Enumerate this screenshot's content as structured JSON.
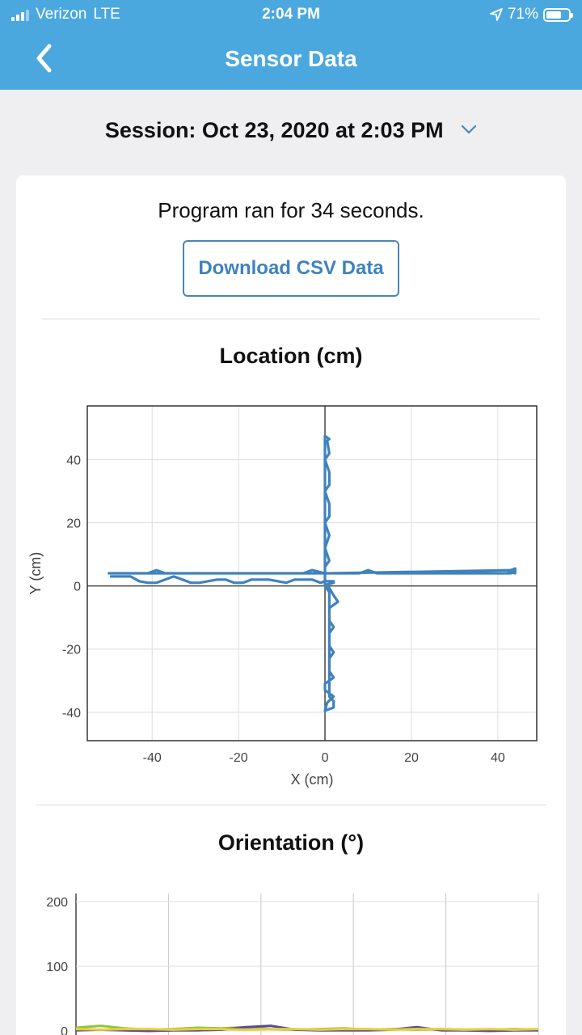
{
  "status_bar": {
    "carrier": "Verizon",
    "network": "LTE",
    "time": "2:04 PM",
    "battery": "71%",
    "battery_level": 0.71
  },
  "nav": {
    "title": "Sensor Data",
    "back_icon": "chevron-left-icon"
  },
  "session": {
    "label": "Session: Oct 23, 2020 at 2:03 PM",
    "dropdown_icon": "chevron-down-icon"
  },
  "summary": {
    "runtime_text": "Program ran for 34 seconds.",
    "download_label": "Download CSV Data"
  },
  "colors": {
    "accent": "#4aa8de",
    "button_text": "#3f82bd",
    "path": "#3f82bd",
    "ori_green": "#8cc63f",
    "ori_purple": "#5b4a9c",
    "ori_yellow": "#e6cf3c"
  },
  "chart_data": [
    {
      "type": "line",
      "title": "Location (cm)",
      "xlabel": "X (cm)",
      "ylabel": "Y (cm)",
      "xlim": [
        -55,
        49
      ],
      "ylim": [
        -49,
        57
      ],
      "x_ticks": [
        -40,
        -20,
        0,
        20,
        40
      ],
      "y_ticks": [
        -40,
        -20,
        0,
        20,
        40
      ],
      "grid": true,
      "series": [
        {
          "points": [
            [
              -49.5,
              3.0
            ],
            [
              -45,
              3.0
            ],
            [
              -43,
              1.5
            ],
            [
              -41,
              1.0
            ],
            [
              -39,
              1.0
            ],
            [
              -35,
              3.0
            ],
            [
              -33,
              2.0
            ],
            [
              -31,
              1.0
            ],
            [
              -29,
              1.0
            ],
            [
              -25,
              2.0
            ],
            [
              -23,
              2.0
            ],
            [
              -21,
              1.0
            ],
            [
              -19,
              1.0
            ],
            [
              -17,
              2.0
            ],
            [
              -13,
              2.0
            ],
            [
              -9,
              1.0
            ],
            [
              -7,
              2.0
            ],
            [
              -3,
              2.0
            ],
            [
              -1,
              1.0
            ],
            [
              0,
              1.5
            ],
            [
              2,
              1.5
            ],
            [
              2,
              1.0
            ],
            [
              0.5,
              0.5
            ],
            [
              2,
              -3
            ],
            [
              3,
              -5
            ],
            [
              1,
              -7
            ],
            [
              1,
              -11
            ],
            [
              2,
              -13
            ],
            [
              1,
              -15
            ],
            [
              1,
              -19
            ],
            [
              2,
              -21
            ],
            [
              1,
              -23
            ],
            [
              1,
              -27
            ],
            [
              2,
              -29
            ],
            [
              0,
              -31
            ],
            [
              0,
              -33
            ],
            [
              2,
              -35
            ],
            [
              0.5,
              -37
            ],
            [
              0,
              -39.5
            ],
            [
              2,
              -38.5
            ],
            [
              2,
              -36.5
            ],
            [
              1,
              -35
            ],
            [
              1,
              -2
            ],
            [
              0,
              0
            ],
            [
              0,
              47.5
            ],
            [
              1,
              46.5
            ],
            [
              0.5,
              46
            ],
            [
              1,
              42
            ],
            [
              0,
              40
            ],
            [
              1,
              36
            ],
            [
              1,
              32
            ],
            [
              0,
              30
            ],
            [
              1,
              26
            ],
            [
              1,
              22
            ],
            [
              0,
              20
            ],
            [
              1,
              16
            ],
            [
              0,
              12
            ],
            [
              1,
              8
            ],
            [
              0,
              6
            ],
            [
              0,
              4
            ],
            [
              -3,
              5
            ],
            [
              -5,
              4
            ],
            [
              -37,
              4
            ],
            [
              -39,
              5
            ],
            [
              -41,
              4
            ],
            [
              -50,
              4
            ],
            [
              -38,
              4
            ],
            [
              1,
              4
            ],
            [
              8,
              4
            ],
            [
              10,
              5
            ],
            [
              12,
              4
            ],
            [
              43,
              4
            ],
            [
              44,
              4.5
            ],
            [
              43,
              5
            ],
            [
              44,
              5.5
            ],
            [
              44,
              4
            ],
            [
              42.5,
              4.5
            ],
            [
              44,
              5
            ],
            [
              1,
              4
            ]
          ]
        }
      ]
    },
    {
      "type": "line",
      "title": "Orientation (°)",
      "xlabel": "",
      "ylabel": "",
      "ylim": [
        0,
        200
      ],
      "y_ticks": [
        0,
        100,
        200
      ],
      "grid": true,
      "series": [
        {
          "color_key": "ori_green",
          "values": [
            5,
            8,
            4,
            2,
            3,
            5,
            4,
            6,
            3,
            2,
            3,
            4,
            2,
            3,
            2,
            3,
            2,
            2,
            3,
            2
          ]
        },
        {
          "color_key": "ori_purple",
          "values": [
            1,
            2,
            1,
            0,
            1,
            1,
            2,
            6,
            8,
            2,
            1,
            1,
            1,
            2,
            6,
            1,
            1,
            0,
            1,
            1
          ]
        },
        {
          "color_key": "ori_yellow",
          "values": [
            3,
            2,
            3,
            3,
            2,
            3,
            3,
            2,
            3,
            3,
            2,
            3,
            3,
            2,
            3,
            3,
            2,
            3,
            2,
            3
          ]
        }
      ]
    }
  ]
}
